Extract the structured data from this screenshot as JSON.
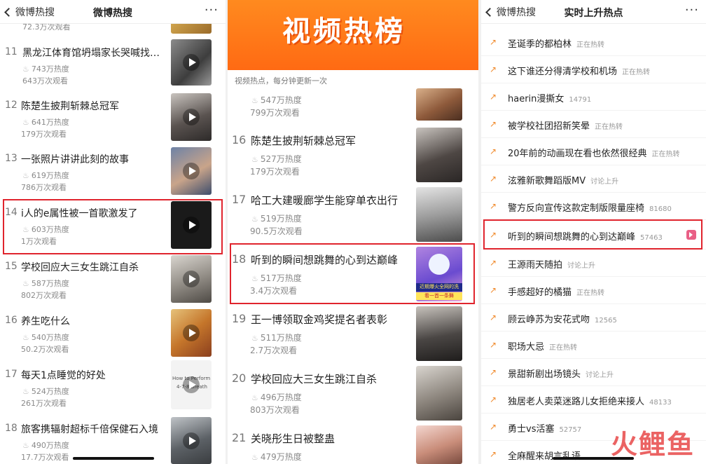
{
  "panel1": {
    "header": {
      "back_label": "微博热搜",
      "title": "微博热搜",
      "more": "···"
    },
    "top_meta": "72.3万次观看",
    "items": [
      {
        "rank": "11",
        "title": "黑龙江体育馆坍塌家长哭喊找…",
        "heat": "743万热度",
        "views": "643万次观看"
      },
      {
        "rank": "12",
        "title": "陈楚生披荆斩棘总冠军",
        "heat": "641万热度",
        "views": "179万次观看"
      },
      {
        "rank": "13",
        "title": "一张照片讲讲此刻的故事",
        "heat": "619万热度",
        "views": "786万次观看"
      },
      {
        "rank": "14",
        "title": "i人的e属性被一首歌激发了",
        "heat": "603万热度",
        "views": "1万次观看"
      },
      {
        "rank": "15",
        "title": "学校回应大三女生跳江自杀",
        "heat": "587万热度",
        "views": "802万次观看"
      },
      {
        "rank": "16",
        "title": "养生吃什么",
        "heat": "540万热度",
        "views": "50.2万次观看"
      },
      {
        "rank": "17",
        "title": "每天1点睡觉的好处",
        "heat": "524万热度",
        "views": "261万次观看"
      },
      {
        "rank": "18",
        "title": "旅客携辐射超标千倍保健石入境",
        "heat": "490万热度",
        "views": "17.7万次观看"
      }
    ],
    "thumb_texts": [
      "How to Perform the",
      "4-7-8 Breath"
    ]
  },
  "panel2": {
    "banner_title": "视频热榜",
    "subtitle": "视频热点，每分钟更新一次",
    "top_heat": "547万热度",
    "top_views": "799万次观看",
    "items": [
      {
        "rank": "16",
        "title": "陈楚生披荆斩棘总冠军",
        "heat": "527万热度",
        "views": "179万次观看"
      },
      {
        "rank": "17",
        "title": "哈工大建暖廊学生能穿单衣出行",
        "heat": "519万热度",
        "views": "90.5万次观看"
      },
      {
        "rank": "18",
        "title": "听到的瞬间想跳舞的心到达巅峰",
        "heat": "517万热度",
        "views": "3.4万次观看"
      },
      {
        "rank": "19",
        "title": "王一博领取金鸡奖提名者表彰",
        "heat": "511万热度",
        "views": "2.7万次观看"
      },
      {
        "rank": "20",
        "title": "学校回应大三女生跳江自杀",
        "heat": "496万热度",
        "views": "803万次观看"
      },
      {
        "rank": "21",
        "title": "关晓彤生日被整蛊",
        "heat": "479万热度",
        "views": ""
      }
    ],
    "thumb_texts": [
      "近期爆火全网的洗",
      "看一首一条舞"
    ]
  },
  "panel3": {
    "header": {
      "back_label": "微博热搜",
      "title": "实时上升热点",
      "more": "···"
    },
    "items": [
      {
        "title": "圣诞季的都柏林",
        "tag": "正在热转"
      },
      {
        "title": "这下谁还分得清学校和机场",
        "tag": "正在热转"
      },
      {
        "title": "haerin漫撕女",
        "tag": "14791"
      },
      {
        "title": "被学校社团招新笑晕",
        "tag": "正在热转"
      },
      {
        "title": "20年前的动画现在看也依然很经典",
        "tag": "正在热转"
      },
      {
        "title": "泫雅新歌舞蹈版MV",
        "tag": "讨论上升"
      },
      {
        "title": "警方反向宣传这款定制版限量座椅",
        "tag": "81680"
      },
      {
        "title": "听到的瞬间想跳舞的心到达巅峰",
        "tag": "57463"
      },
      {
        "title": "王源雨天随拍",
        "tag": "讨论上升"
      },
      {
        "title": "手感超好的橘猫",
        "tag": "正在热转"
      },
      {
        "title": "顾云峥苏为安花式吻",
        "tag": "12565"
      },
      {
        "title": "职场大忌",
        "tag": "正在热转"
      },
      {
        "title": "景甜新剧出场镜头",
        "tag": "讨论上升"
      },
      {
        "title": "独居老人卖菜迷路儿女拒绝来接人",
        "tag": "48133"
      },
      {
        "title": "勇士vs活塞",
        "tag": "52757"
      },
      {
        "title": "全麻醒来胡言乱语",
        "tag": ""
      }
    ]
  },
  "watermark": "火鲤鱼",
  "colors": {
    "accent_red": "#e0242d",
    "banner_orange": "#ff6a13",
    "arrow_orange": "#f08a2c"
  }
}
